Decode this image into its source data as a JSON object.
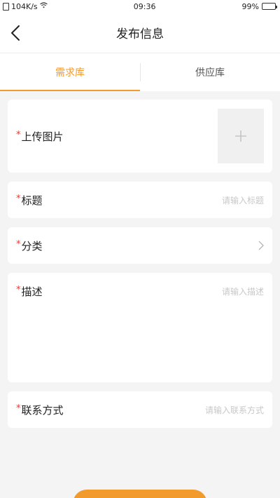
{
  "status_bar": {
    "speed": "104K/s",
    "time": "09:36",
    "battery": "99%"
  },
  "nav": {
    "title": "发布信息"
  },
  "tabs": [
    {
      "label": "需求库",
      "active": true
    },
    {
      "label": "供应库",
      "active": false
    }
  ],
  "form": {
    "required_mark": "*",
    "upload": {
      "label": "上传图片"
    },
    "title": {
      "label": "标题",
      "placeholder": "请输入标题"
    },
    "category": {
      "label": "分类"
    },
    "description": {
      "label": "描述",
      "placeholder": "请输入描述"
    },
    "contact": {
      "label": "联系方式",
      "placeholder": "请输入联系方式"
    }
  },
  "colors": {
    "accent": "#f39a2d",
    "required": "#e53935"
  }
}
